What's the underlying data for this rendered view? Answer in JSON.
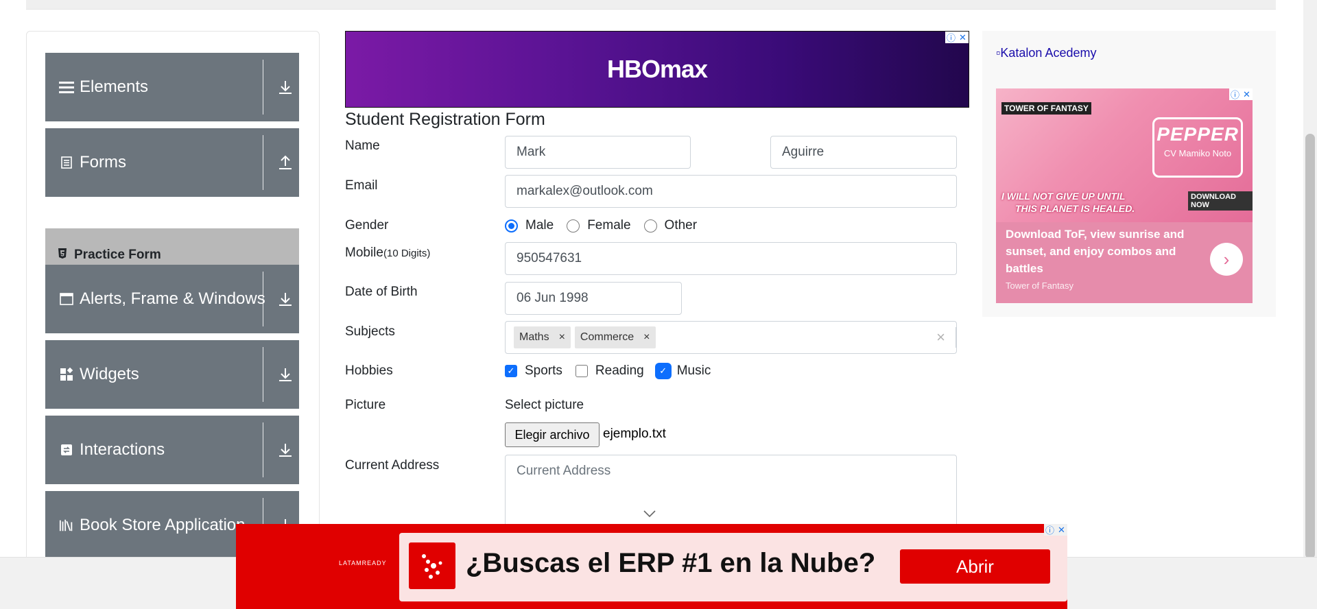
{
  "sidebar": {
    "groups": [
      {
        "title": "Elements",
        "icon": "menu-icon",
        "arrow": "download-icon"
      },
      {
        "title": "Forms",
        "icon": "document-icon",
        "arrow": "upload-icon"
      },
      {
        "title": "Alerts, Frame & Windows",
        "icon": "window-icon",
        "arrow": "download-icon"
      },
      {
        "title": "Widgets",
        "icon": "widgets-icon",
        "arrow": "download-icon"
      },
      {
        "title": "Interactions",
        "icon": "interactions-icon",
        "arrow": "download-icon"
      },
      {
        "title": "Book Store Application",
        "icon": "books-icon",
        "arrow": "download-icon"
      }
    ],
    "active_item": {
      "label": "Practice Form",
      "icon": "html5-icon"
    }
  },
  "ad_top": {
    "brand": "HBOmax"
  },
  "form": {
    "title": "Student Registration Form",
    "name_label": "Name",
    "first_name": "Mark",
    "last_name": "Aguirre",
    "email_label": "Email",
    "email": "markalex@outlook.com",
    "gender_label": "Gender",
    "gender_options": [
      "Male",
      "Female",
      "Other"
    ],
    "gender_selected": "Male",
    "mobile_label": "Mobile",
    "mobile_hint": "(10 Digits)",
    "mobile": "950547631",
    "dob_label": "Date of Birth",
    "dob": "06 Jun 1998",
    "subjects_label": "Subjects",
    "subjects": [
      "Maths",
      "Commerce"
    ],
    "hobbies_label": "Hobbies",
    "hobbies": [
      {
        "label": "Sports",
        "checked": true
      },
      {
        "label": "Reading",
        "checked": false
      },
      {
        "label": "Music",
        "checked": true
      }
    ],
    "picture_label": "Picture",
    "picture_prompt": "Select picture",
    "file_button": "Elegir archivo",
    "file_name": "ejemplo.txt",
    "address_label": "Current Address",
    "address_placeholder": "Current Address"
  },
  "ad_right": {
    "alt_link": "Katalon Acedemy",
    "tower": "TOWER OF FANTASY",
    "pepper_title": "PEPPER",
    "pepper_sub": "CV Mamiko Noto",
    "slogan_1": "I WILL NOT GIVE UP UNTIL",
    "slogan_2": "THIS PLANET IS HEALED.",
    "download_badge": "DOWNLOAD NOW",
    "body": "Download ToF, view sunrise and sunset, and enjoy combos and battles",
    "source": "Tower of Fantasy"
  },
  "ad_bottom": {
    "brand": "LATAMREADY",
    "headline": "¿Buscas el ERP #1 en la Nube?",
    "cta": "Abrir"
  },
  "colors": {
    "sidebar_header": "#6c757d",
    "sidebar_active": "#b8b8b8",
    "accent": "#0d6efd",
    "ad_red": "#e00000"
  }
}
